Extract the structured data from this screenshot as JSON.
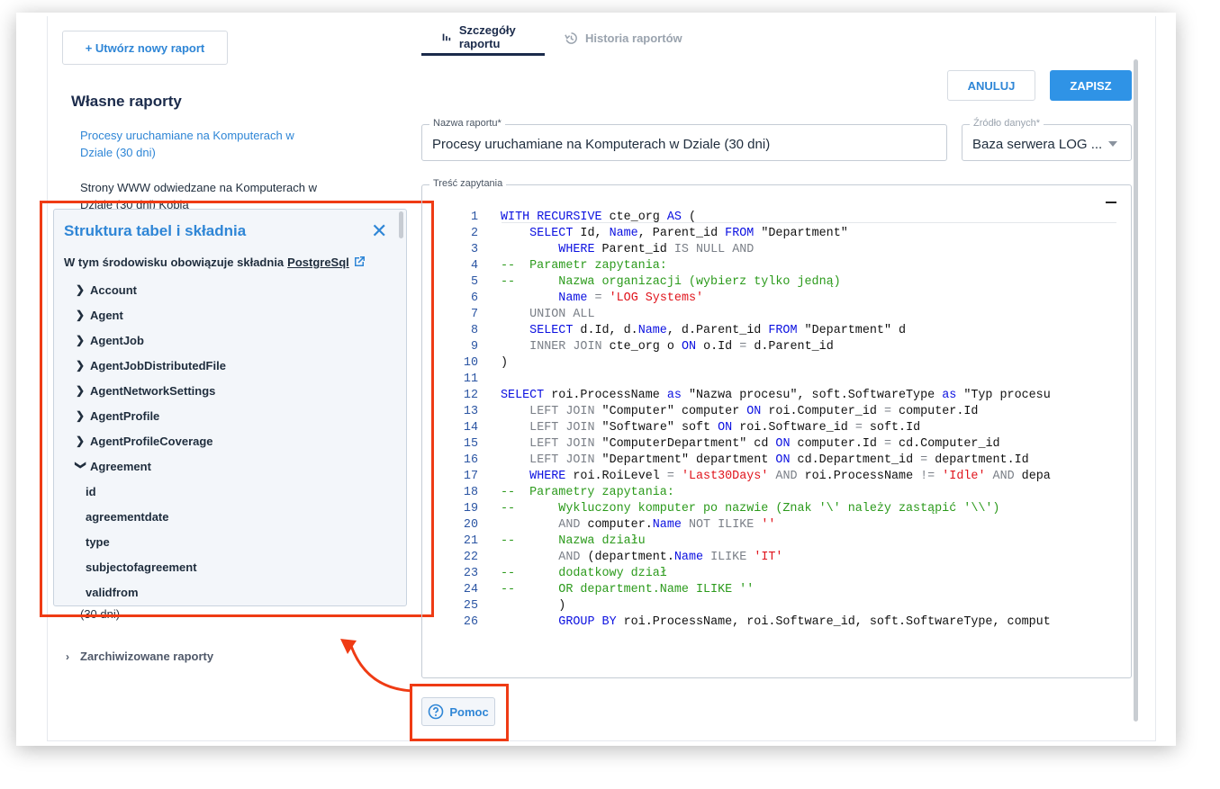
{
  "sidebar": {
    "new_report_label": "+ Utwórz nowy raport",
    "section_title": "Własne raporty",
    "reports": [
      "Procesy uruchamiane na Komputerach w Dziale (30 dni)",
      "Strony WWW odwiedzane na Komputerach w Dziale (30 dni) Kobia"
    ],
    "report_peek": "(30 dni)",
    "archived_label": "Zarchiwizowane raporty"
  },
  "help_panel": {
    "title": "Struktura tabel i składnia",
    "note_prefix": "W tym środowisku obowiązuje składnia",
    "note_link": "PostgreSql",
    "tables": [
      {
        "name": "Account",
        "expanded": false
      },
      {
        "name": "Agent",
        "expanded": false
      },
      {
        "name": "AgentJob",
        "expanded": false
      },
      {
        "name": "AgentJobDistributedFile",
        "expanded": false
      },
      {
        "name": "AgentNetworkSettings",
        "expanded": false
      },
      {
        "name": "AgentProfile",
        "expanded": false
      },
      {
        "name": "AgentProfileCoverage",
        "expanded": false
      },
      {
        "name": "Agreement",
        "expanded": true
      }
    ],
    "agreement_columns": [
      "id",
      "agreementdate",
      "type",
      "subjectofagreement",
      "validfrom"
    ]
  },
  "tabs": [
    {
      "label": "Szczegóły raportu",
      "icon": "bar-chart-icon",
      "active": true
    },
    {
      "label": "Historia raportów",
      "icon": "history-icon",
      "active": false
    }
  ],
  "toolbar": {
    "cancel_label": "ANULUJ",
    "save_label": "ZAPISZ"
  },
  "form": {
    "name_label": "Nazwa raportu*",
    "name_value": "Procesy uruchamiane na Komputerach w Dziale (30 dni)",
    "source_label": "Źródło danych*",
    "source_value": "Baza serwera LOG ...",
    "query_label": "Treść zapytania"
  },
  "code_lines": [
    "WITH RECURSIVE cte_org AS (",
    "    SELECT Id, Name, Parent_id FROM \"Department\"",
    "        WHERE Parent_id IS NULL AND",
    "--  Parametr zapytania:",
    "--      Nazwa organizacji (wybierz tylko jedną)",
    "        Name = 'LOG Systems'",
    "    UNION ALL",
    "    SELECT d.Id, d.Name, d.Parent_id FROM \"Department\" d",
    "    INNER JOIN cte_org o ON o.Id = d.Parent_id",
    ")",
    "",
    "SELECT roi.ProcessName as \"Nazwa procesu\", soft.SoftwareType as \"Typ procesu",
    "    LEFT JOIN \"Computer\" computer ON roi.Computer_id = computer.Id",
    "    LEFT JOIN \"Software\" soft ON roi.Software_id = soft.Id",
    "    LEFT JOIN \"ComputerDepartment\" cd ON computer.Id = cd.Computer_id",
    "    LEFT JOIN \"Department\" department ON cd.Department_id = department.Id",
    "    WHERE roi.RoiLevel = 'Last30Days' AND roi.ProcessName != 'Idle' AND depa",
    "--  Parametry zapytania:",
    "--      Wykluczony komputer po nazwie (Znak '\\' należy zastąpić '\\\\')",
    "        AND computer.Name NOT ILIKE ''",
    "--      Nazwa działu",
    "        AND (department.Name ILIKE 'IT'",
    "--      dodatkowy dział",
    "--      OR department.Name ILIKE ''",
    "        )",
    "        GROUP BY roi.ProcessName, roi.Software_id, soft.SoftwareType, comput"
  ],
  "help_button_label": "Pomoc",
  "colors": {
    "accent": "#2f86d6",
    "highlight": "#ef3b14",
    "keyword": "#0b10e0",
    "comment": "#2b9a1b",
    "string": "#e0141c"
  }
}
